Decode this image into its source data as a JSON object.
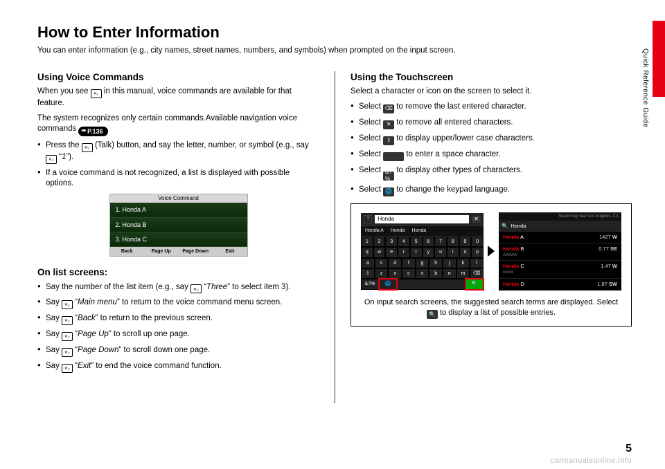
{
  "side_label": "Quick Reference Guide",
  "title": "How to Enter Information",
  "intro": "You can enter information (e.g., city names, street names, numbers, and symbols) when prompted on the input screen.",
  "left": {
    "h_voice": "Using Voice Commands",
    "voice_p1a": "When you see ",
    "voice_p1b": " in this manual, voice commands are available for that feature.",
    "voice_p2": "The system recognizes only certain commands.Available navigation voice commands ",
    "pill": "P.136",
    "voice_b1a": "Press the ",
    "voice_b1b": " (Talk) button, and say the letter, number, or symbol (e.g., say ",
    "voice_b1c": " “",
    "voice_b1_cmd": "1",
    "voice_b1d": "”).",
    "voice_b2": "If a voice command is not recognized, a list is displayed with possible options.",
    "vc": {
      "title": "Voice Command",
      "items": [
        "1. Honda A",
        "2. Honda B",
        "3. Honda C"
      ],
      "footer": [
        "Back",
        "Page Up",
        "Page Down",
        "Exit"
      ]
    },
    "h_list": "On list screens:",
    "list": [
      {
        "pre": "Say the number of the list item (e.g., say ",
        "cmd": "Three",
        "post": "” to select item 3)."
      },
      {
        "pre": "Say ",
        "cmd": "Main menu",
        "post": "” to return to the voice command menu screen."
      },
      {
        "pre": "Say ",
        "cmd": "Back",
        "post": "” to return to the previous screen."
      },
      {
        "pre": "Say ",
        "cmd": "Page Up",
        "post": "” to scroll up one page."
      },
      {
        "pre": "Say ",
        "cmd": "Page Down",
        "post": "” to scroll down one page."
      },
      {
        "pre": "Say ",
        "cmd": "Exit",
        "post": "” to end the voice command function."
      }
    ]
  },
  "right": {
    "h_touch": "Using the Touchscreen",
    "touch_p": "Select a character or icon on the screen to select it.",
    "items": [
      {
        "pre": "Select ",
        "icon": "backspace",
        "post": " to remove the last entered character."
      },
      {
        "pre": "Select ",
        "icon": "clear",
        "post": " to remove all entered characters."
      },
      {
        "pre": "Select ",
        "icon": "shift",
        "post": " to display upper/lower case characters."
      },
      {
        "pre": "Select ",
        "icon": "space",
        "post": " to enter a space character."
      },
      {
        "pre": "Select ",
        "icon": "symbols",
        "post": " to display other types of characters."
      },
      {
        "pre": "Select ",
        "icon": "globe",
        "post": " to change the keypad language."
      }
    ],
    "kbd": {
      "input": "Honda",
      "suggest": [
        "Honda A",
        "Honda",
        "Honda"
      ],
      "row1": [
        "1",
        "2",
        "3",
        "4",
        "5",
        "6",
        "7",
        "8",
        "9",
        "0"
      ],
      "row2": [
        "q",
        "w",
        "e",
        "r",
        "t",
        "y",
        "u",
        "i",
        "o",
        "p"
      ],
      "row3": [
        "a",
        "s",
        "d",
        "f",
        "g",
        "h",
        "j",
        "k",
        "l"
      ],
      "row4_shift": "⇧",
      "row4": [
        "z",
        "x",
        "c",
        "v",
        "b",
        "n",
        "m"
      ],
      "row4_bksp": "⌫",
      "row5_sym": "&?%",
      "row5_globe": "🌐",
      "row5_search": "🔍"
    },
    "results": {
      "corner": "Searching near Los Angeles, CA",
      "query_icon": "🔍",
      "query": "Honda",
      "rows": [
        {
          "name": "Honda",
          "suf": " A",
          "sub": "",
          "dist": "1427",
          "dir": "W"
        },
        {
          "name": "Honda",
          "suf": " B",
          "sub": "AAAAA",
          "dist": "0.77",
          "dir": "SE"
        },
        {
          "name": "Honda",
          "suf": " C",
          "sub": "xxxxx",
          "dist": "1.47",
          "dir": "W"
        },
        {
          "name": "Honda",
          "suf": " D",
          "sub": "",
          "dist": "1.87",
          "dir": "SW"
        }
      ]
    },
    "caption_a": "On input search screens, the suggested search terms are displayed. Select ",
    "caption_b": " to display a list of possible entries."
  },
  "page_num": "5",
  "watermark": "carmanualsonline.info"
}
